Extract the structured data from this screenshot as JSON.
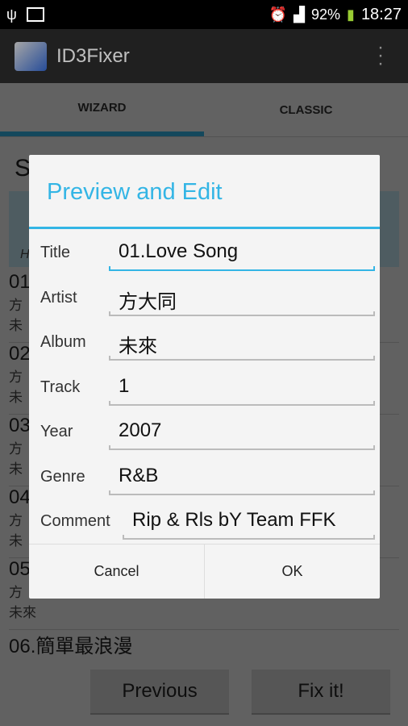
{
  "status_bar": {
    "battery": "92%",
    "time": "18:27",
    "icons": [
      "usb-icon",
      "image-icon",
      "alarm-icon",
      "signal-icon",
      "battery-icon"
    ]
  },
  "app": {
    "title": "ID3Fixer"
  },
  "tabs": [
    {
      "label": "WIZARD",
      "active": true
    },
    {
      "label": "CLASSIC",
      "active": false
    }
  ],
  "background": {
    "heading_fragment": "S",
    "hint_fragment": "H",
    "rows": [
      {
        "num": "01",
        "a": "方",
        "b": "未"
      },
      {
        "num": "02",
        "a": "方",
        "b": "未"
      },
      {
        "num": "03",
        "a": "方",
        "b": "未"
      },
      {
        "num": "04",
        "a": "方",
        "b": "未"
      },
      {
        "num": "05",
        "a": "方",
        "b": "未來"
      },
      {
        "num": "06.簡單最浪漫",
        "a": "",
        "b": ""
      }
    ],
    "previous": "Previous",
    "fix": "Fix it!"
  },
  "dialog": {
    "title": "Preview and Edit",
    "fields": [
      {
        "label": "Title",
        "value": "01.Love Song",
        "focused": true
      },
      {
        "label": "Artist",
        "value": "方大同"
      },
      {
        "label": "Album",
        "value": "未來"
      },
      {
        "label": "Track",
        "value": "1"
      },
      {
        "label": "Year",
        "value": "2007"
      },
      {
        "label": "Genre",
        "value": "R&B"
      },
      {
        "label": "Comment",
        "value": "Rip & Rls bY Team FFK"
      }
    ],
    "cancel": "Cancel",
    "ok": "OK"
  },
  "colors": {
    "accent": "#33b5e5"
  }
}
